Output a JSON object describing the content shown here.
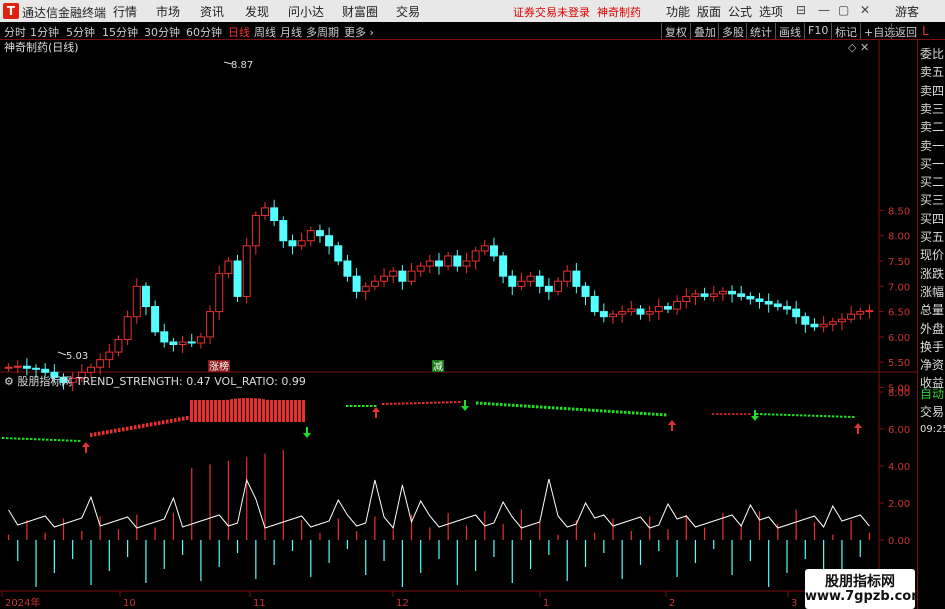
{
  "app": {
    "logo_glyph": "T",
    "title": "通达信金融终端",
    "menus": [
      "行情",
      "市场",
      "资讯",
      "发现",
      "问小达",
      "财富圈",
      "交易"
    ],
    "warning": "证券交易未登录",
    "stock_name_top": "神奇制药",
    "right_menus": [
      "功能",
      "版面",
      "公式",
      "选项"
    ],
    "user": "游客",
    "win_icons": [
      "winmenu-icon",
      "minimize-icon",
      "maximize-icon",
      "close-icon"
    ],
    "win_glyphs": [
      "⊟",
      "—",
      "▢",
      "✕"
    ]
  },
  "toolbar": {
    "periods": [
      "分时",
      "1分钟",
      "5分钟",
      "15分钟",
      "30分钟",
      "60分钟",
      "日线",
      "周线",
      "月线",
      "多周期",
      "更多"
    ],
    "active_period": "日线",
    "more_arrow": "›",
    "right_buttons": [
      "复权",
      "叠加",
      "多股",
      "统计",
      "画线",
      "F10",
      "标记",
      "+自选",
      "返回"
    ]
  },
  "main_chart": {
    "title": "神奇制药(日线)",
    "y_ticks": [
      "8.50",
      "8.00",
      "7.50",
      "7.00",
      "6.50",
      "6.00",
      "5.50",
      "5.00"
    ],
    "high_label": "8.87",
    "low_label": "5.03",
    "tag_up": "涨榜",
    "tag_down": "减",
    "up_color": "#e83030",
    "down_color": "#54ffff"
  },
  "indicator": {
    "title": "股朋指标网",
    "trend_label": "TREND_STRENGTH: 0.47",
    "vol_label": "VOL_RATIO: 0.99",
    "y_ticks": [
      "8.00",
      "6.00",
      "4.00",
      "2.00",
      "0.00"
    ],
    "strong_color": "#e83030",
    "weak_color": "#22dd22"
  },
  "x_axis": {
    "labels": [
      "2024年",
      "10",
      "11",
      "12",
      "1",
      "2",
      "3"
    ]
  },
  "right_panel": {
    "items": [
      "委比",
      "卖五",
      "卖四",
      "卖三",
      "卖二",
      "卖一",
      "买一",
      "买二",
      "买三",
      "买四",
      "买五",
      "现价",
      "涨跌",
      "涨幅",
      "总量",
      "外盘",
      "换手",
      "净资",
      "收益"
    ],
    "auto_label": "自动",
    "trade_label": "交易",
    "time": "09:25",
    "L": "L"
  },
  "watermark": {
    "line1": "股朋指标网",
    "line2": "www.7gpzb.com"
  }
}
